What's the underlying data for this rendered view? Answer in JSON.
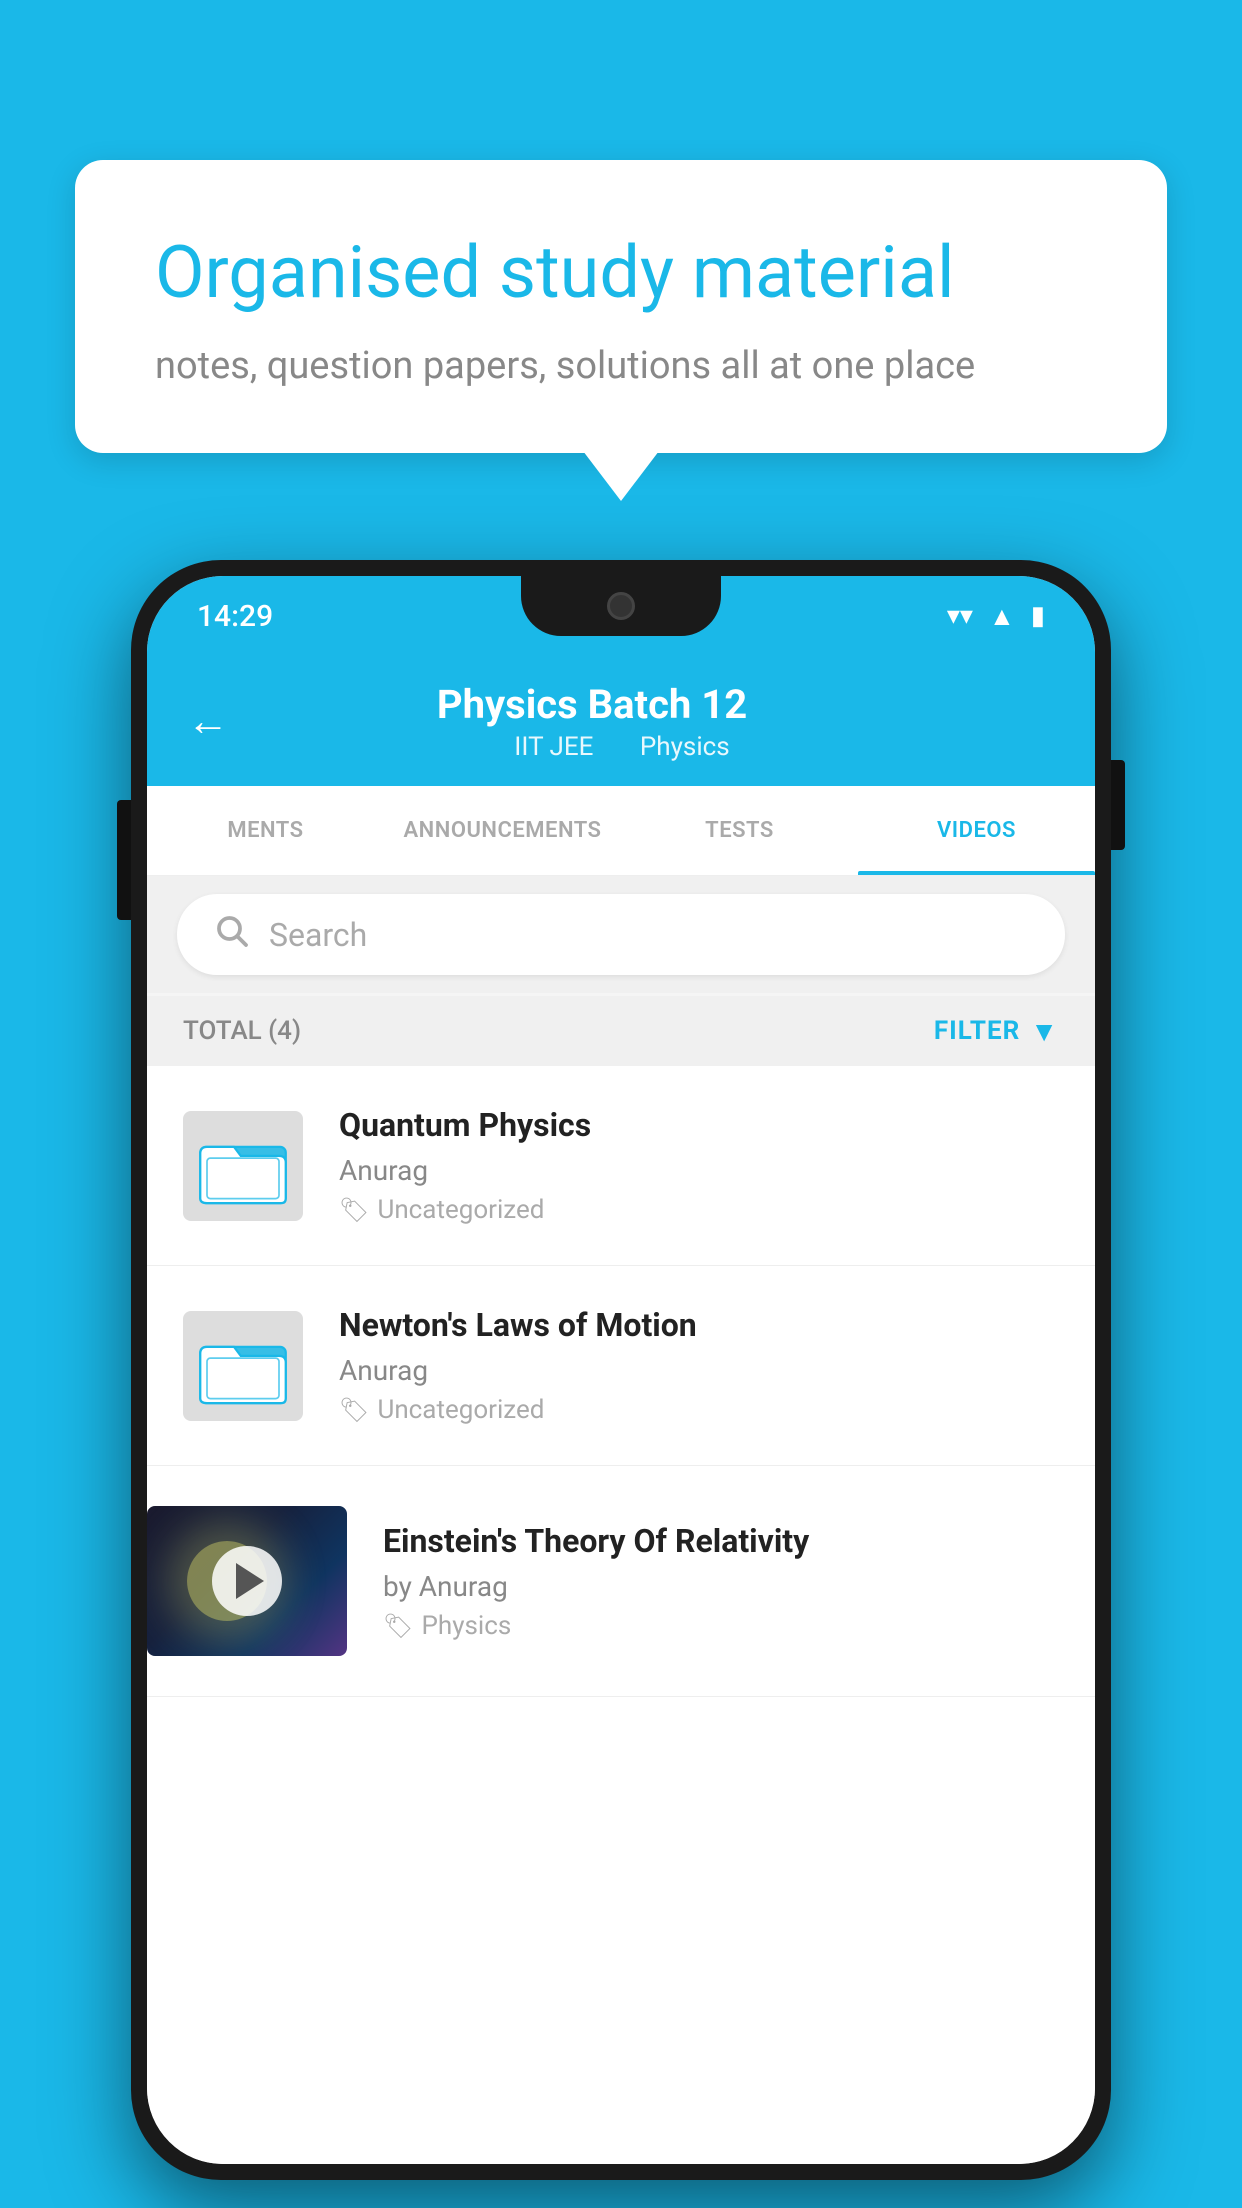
{
  "background_color": "#1ab8e8",
  "bubble": {
    "heading": "Organised study material",
    "subtext": "notes, question papers, solutions all at one place"
  },
  "status_bar": {
    "time": "14:29",
    "wifi": "▼",
    "signal": "▲",
    "battery": "▮"
  },
  "header": {
    "title": "Physics Batch 12",
    "subtitle_left": "IIT JEE",
    "subtitle_right": "Physics",
    "back_label": "←"
  },
  "tabs": [
    {
      "label": "MENTS",
      "active": false
    },
    {
      "label": "ANNOUNCEMENTS",
      "active": false
    },
    {
      "label": "TESTS",
      "active": false
    },
    {
      "label": "VIDEOS",
      "active": true
    }
  ],
  "search": {
    "placeholder": "Search"
  },
  "filter_bar": {
    "total_label": "TOTAL (4)",
    "filter_label": "FILTER"
  },
  "videos": [
    {
      "id": 1,
      "title": "Quantum Physics",
      "author": "Anurag",
      "tag": "Uncategorized",
      "has_thumbnail": false
    },
    {
      "id": 2,
      "title": "Newton's Laws of Motion",
      "author": "Anurag",
      "tag": "Uncategorized",
      "has_thumbnail": false
    },
    {
      "id": 3,
      "title": "Einstein's Theory Of Relativity",
      "author": "by Anurag",
      "tag": "Physics",
      "has_thumbnail": true
    }
  ]
}
